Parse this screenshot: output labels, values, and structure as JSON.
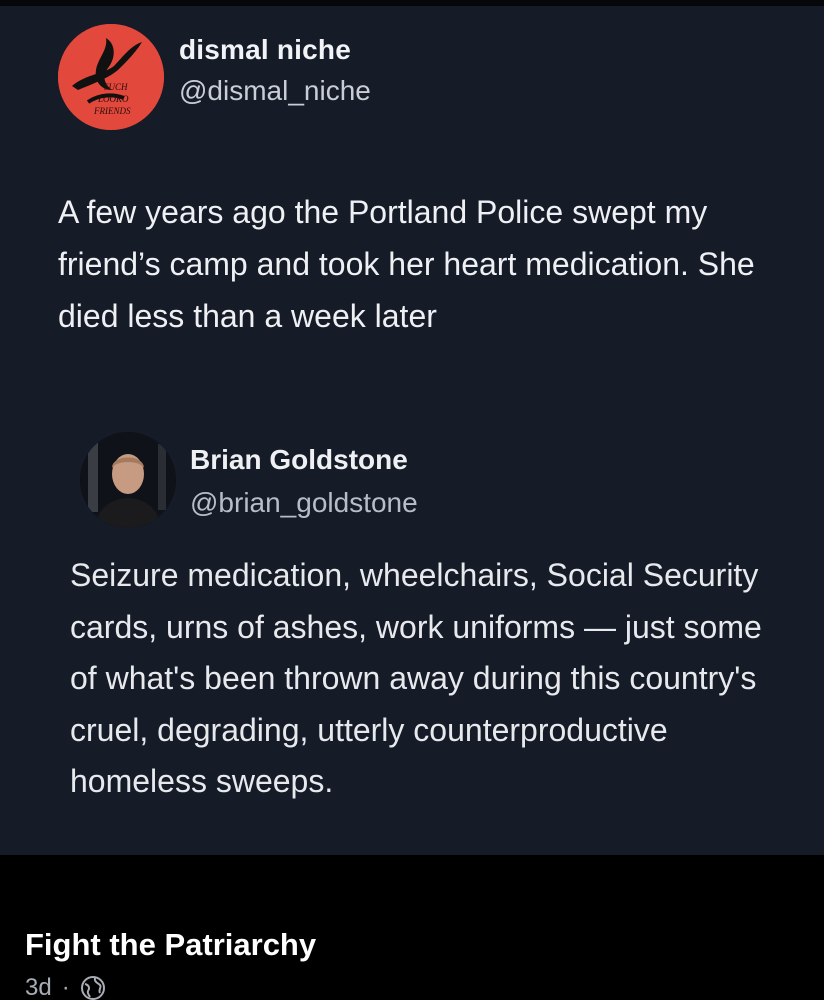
{
  "tweet": {
    "author": {
      "display_name": "dismal niche",
      "handle": "@dismal_niche",
      "avatar_color": "#e2483c",
      "avatar_logo_text": "SUCH\nLOOKO\nFRIENDS"
    },
    "text": "A few years ago the Portland Police swept my friend’s camp and took her heart medication. She died less than a week later",
    "quoted": {
      "display_name": "Brian Goldstone",
      "handle": "@brian_goldstone",
      "text": "Seizure medication, wheelchairs, Social Security cards, urns of ashes, work uniforms — just some of what's been thrown away during this country's cruel, degrading, utterly counterproductive homeless sweeps."
    },
    "background_color": "#151b27"
  },
  "post": {
    "page_name": "Fight the Patriarchy",
    "age": "3d",
    "separator": "·",
    "audience_icon": "globe-icon"
  }
}
